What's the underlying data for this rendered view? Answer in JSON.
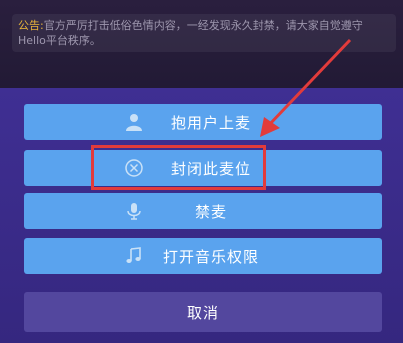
{
  "announcement": {
    "tag": "公告:",
    "text": "官方严厉打击低俗色情内容，一经发现永久封禁，请大家自觉遵守Hello平台秩序。"
  },
  "menu": {
    "items": [
      {
        "label": "抱用户上麦",
        "icon": "user-up-icon"
      },
      {
        "label": "封闭此麦位",
        "icon": "close-circle-icon"
      },
      {
        "label": "禁麦",
        "icon": "mic-icon"
      },
      {
        "label": "打开音乐权限",
        "icon": "music-note-icon"
      }
    ],
    "cancel_label": "取消"
  },
  "colors": {
    "button": "#5aa3ee",
    "sheet": "#3f2f93",
    "highlight": "#e23b3b",
    "announcement_tag": "#e6b33b"
  }
}
